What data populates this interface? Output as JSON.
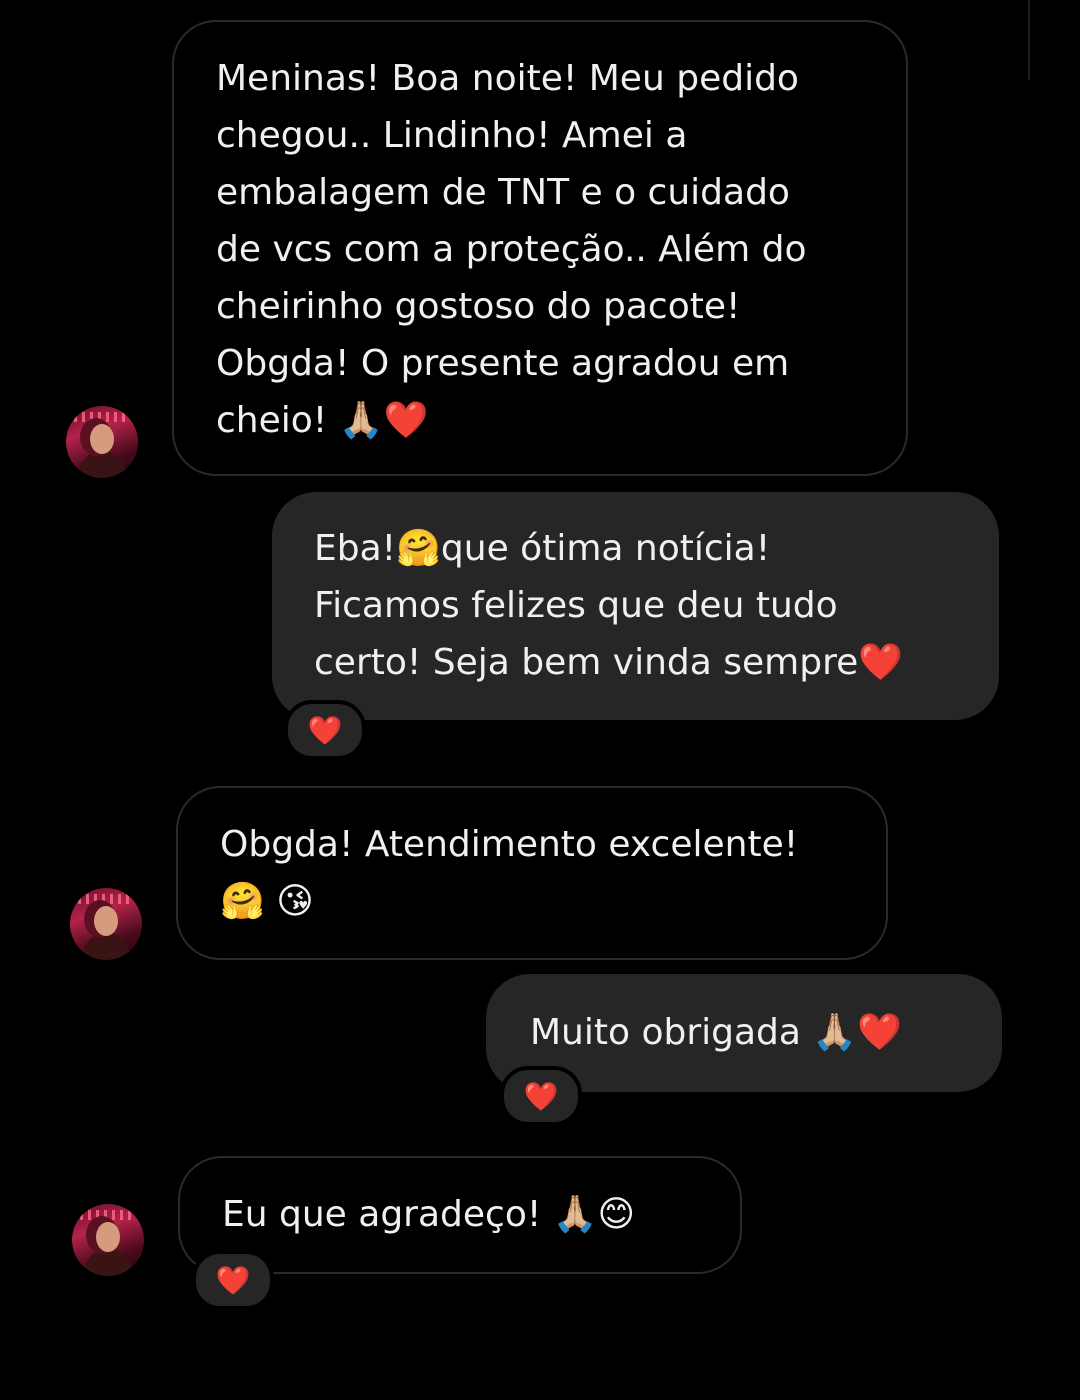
{
  "messages": [
    {
      "sender": "other",
      "text": "Meninas! Boa noite! Meu pedido\nchegou.. Lindinho! Amei a\nembalagem de TNT e o cuidado\nde vcs com a proteção.. Além do\ncheirinho gostoso do pacote!\nObgda! O presente agradou em\ncheio! 🙏🏼❤️"
    },
    {
      "sender": "me",
      "text": "Eba!🤗que ótima notícia!\nFicamos felizes que deu tudo\ncerto! Seja bem vinda sempre❤️",
      "reaction": "❤️"
    },
    {
      "sender": "other",
      "text": "Obgda! Atendimento excelente!\n🤗 😘"
    },
    {
      "sender": "me",
      "text": "Muito obrigada 🙏🏼❤️",
      "reaction": "❤️"
    },
    {
      "sender": "other",
      "text": "Eu que agradeço! 🙏🏼😊",
      "reaction": "❤️"
    }
  ],
  "colors": {
    "background": "#000000",
    "outgoing_bubble": "#262626",
    "incoming_border": "#2a2a2a",
    "heart": "#e8202c"
  }
}
